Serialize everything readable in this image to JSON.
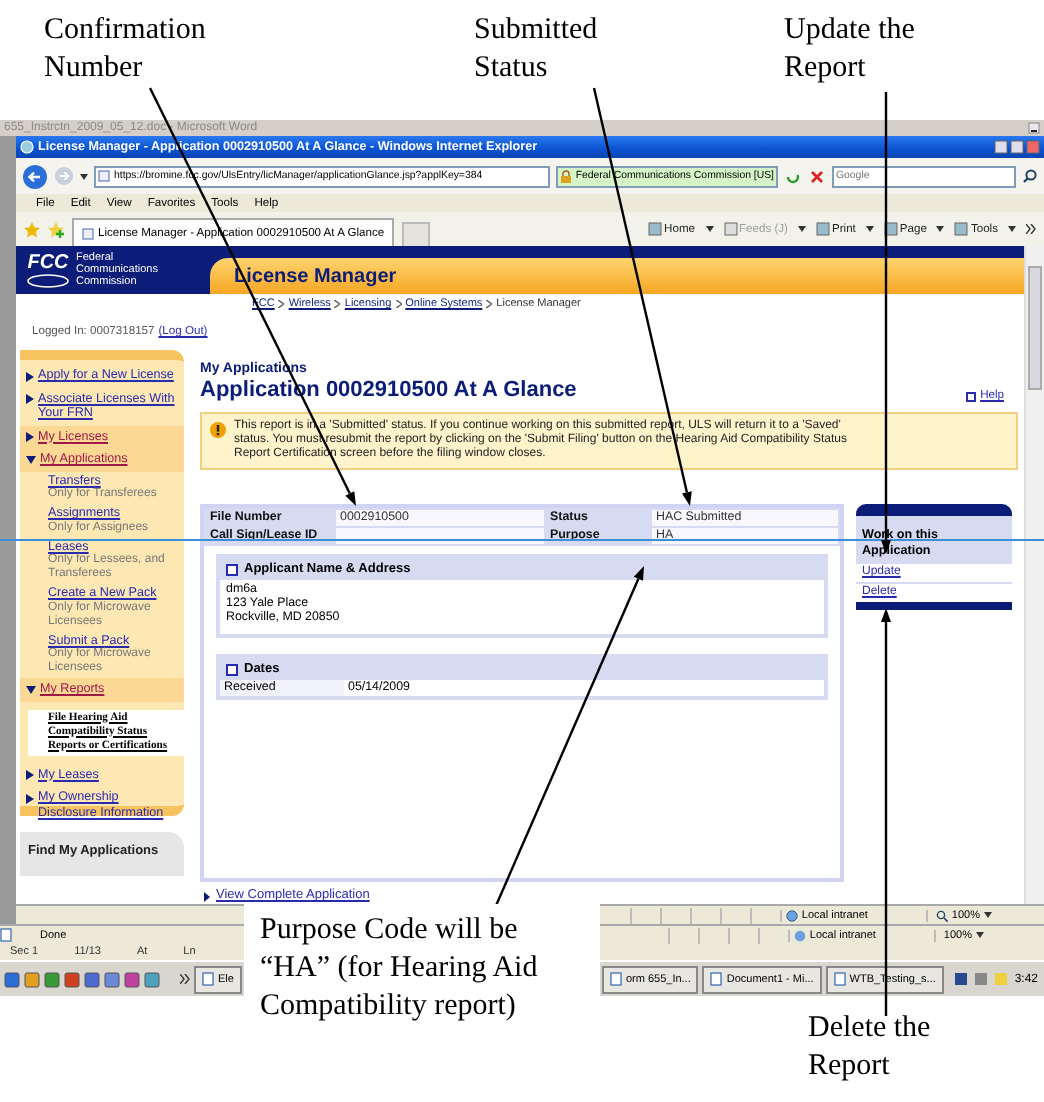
{
  "callouts": [
    {
      "text": "Confirmation Number"
    },
    {
      "text": "Submitted Status"
    },
    {
      "text": "Update the Report"
    },
    {
      "text": "Purpose Code will be “HA” (for Hearing Aid Compatibility report)"
    },
    {
      "text": "Delete the Report"
    }
  ],
  "word": {
    "title": "655_Instrctn_2009_05_12.doc - Microsoft Word",
    "status": [
      "Sec 1",
      "11/13",
      "At",
      "Ln"
    ]
  },
  "browser": {
    "title": "License Manager - Application 0002910500 At A Glance - Windows Internet Explorer",
    "address": "https://bromine.fcc.gov/UlsEntry/licManager/applicationGlance.jsp?applKey=384",
    "site_identity": "Federal Communications Commission [US]",
    "search_placeholder": "Google",
    "menu": [
      "File",
      "Edit",
      "View",
      "Favorites",
      "Tools",
      "Help"
    ],
    "tab": "License Manager - Application 0002910500 At A Glance",
    "commands": [
      {
        "label": "Home",
        "disabled": false
      },
      {
        "label": "Feeds (J)",
        "disabled": true
      },
      {
        "label": "Print",
        "disabled": false
      },
      {
        "label": "Page",
        "disabled": false
      },
      {
        "label": "Tools",
        "disabled": false
      }
    ],
    "status": {
      "zone": "Local intranet",
      "zoom": "100%"
    }
  },
  "page": {
    "header": {
      "logo": "FCC",
      "agency": "Federal Communications Commission",
      "app_title": "License Manager",
      "breadcrumb": [
        {
          "label": "FCC",
          "current": false
        },
        {
          "label": "Wireless",
          "current": false
        },
        {
          "label": "Licensing",
          "current": false
        },
        {
          "label": "Online Systems",
          "current": false
        },
        {
          "label": "License Manager",
          "current": true
        }
      ]
    },
    "logged_in": "Logged In: 0007318157",
    "logout": "(Log Out)",
    "sidebar": {
      "items": [
        {
          "label": "Apply for a New License",
          "kind": "link",
          "expanded": false
        },
        {
          "label": "Associate Licenses With Your FRN",
          "kind": "link",
          "expanded": false
        },
        {
          "label": "My Licenses",
          "kind": "section",
          "expanded": false
        },
        {
          "label": "My Applications",
          "kind": "section",
          "expanded": true,
          "children": [
            {
              "label": "Transfers",
              "note": "Only for Transferees",
              "kind": "link"
            },
            {
              "label": "Assignments",
              "note": "Only for Assignees",
              "kind": "link"
            },
            {
              "label": "Leases",
              "note": "Only for Lessees, and Transferees",
              "kind": "link"
            },
            {
              "label": "Create a New Pack",
              "note": "Only for Microwave Licensees",
              "kind": "link"
            },
            {
              "label": "Submit a Pack",
              "note": "Only for Microwave Licensees",
              "kind": "link"
            }
          ]
        },
        {
          "label": "My Reports",
          "kind": "section",
          "expanded": true,
          "children": [
            {
              "label": "File Hearing Aid Compatibility Status Reports or Certifications",
              "kind": "pasted"
            }
          ]
        },
        {
          "label": "My Leases",
          "kind": "link",
          "expanded": false
        },
        {
          "label": "My Ownership Disclosure Information",
          "kind": "link",
          "expanded": false
        }
      ],
      "find_panel": "Find My Applications"
    },
    "main": {
      "section": "My Applications",
      "title": "Application 0002910500 At A Glance",
      "help": "Help",
      "warning": "This report is in a 'Submitted' status. If you continue working on this submitted report, ULS will return it to a 'Saved' status. You must resubmit the report by clicking on the 'Submit Filing' button on the Hearing Aid Compatibility Status Report Certification screen before the filing window closes.",
      "fields": [
        {
          "label": "File Number",
          "value": "0002910500"
        },
        {
          "label": "Status",
          "value": "HAC Submitted"
        },
        {
          "label": "Call Sign/Lease ID"
        },
        {
          "label": "Purpose",
          "value": "HA"
        }
      ],
      "applicant": {
        "title": "Applicant Name & Address",
        "lines": [
          "dm6a",
          "123 Yale Place",
          "Rockville, MD 20850"
        ]
      },
      "dates": {
        "title": "Dates",
        "rows": [
          {
            "label": "Received",
            "value": "05/14/2009"
          }
        ]
      },
      "view_link": "View Complete Application",
      "actions": {
        "title": "Work on this Application",
        "links": [
          "Update",
          "Delete"
        ]
      }
    }
  },
  "status_behind": {
    "text": "Done",
    "zone": "Local intranet",
    "zoom": "100%"
  },
  "taskbar": {
    "items": [
      "Ele",
      "orm 655_In...",
      "Document1 - Mi...",
      "WTB_Testing_s..."
    ],
    "clock": "3:42"
  }
}
